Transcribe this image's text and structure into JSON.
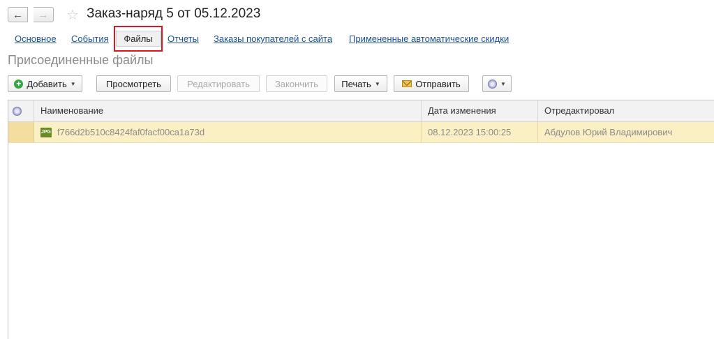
{
  "window": {
    "title": "Заказ-наряд 5 от 05.12.2023",
    "back_glyph": "←",
    "forward_glyph": "→",
    "favorite_glyph": "☆"
  },
  "tabs": [
    {
      "label": "Основное"
    },
    {
      "label": "События"
    },
    {
      "label": "Файлы",
      "active": true
    },
    {
      "label": "Отчеты"
    },
    {
      "label": "Заказы покупателей с сайта"
    },
    {
      "label": "Примененные автоматические скидки"
    }
  ],
  "section_title": "Присоединенные файлы",
  "toolbar": {
    "add": "Добавить",
    "view": "Просмотреть",
    "edit": "Редактировать",
    "finish": "Закончить",
    "print": "Печать",
    "send": "Отправить"
  },
  "icons": {
    "add": "plus-circle-icon",
    "send": "envelope-icon",
    "more": "more-actions-icon",
    "file": "jpg-file-icon"
  },
  "colors": {
    "link": "#1a4f9a",
    "highlight_border": "#e0141e",
    "selected_row": "#fbf0c4",
    "add_icon": "#37a547"
  },
  "table": {
    "columns": [
      "Наименование",
      "Дата изменения",
      "Отредактировал"
    ],
    "rows": [
      {
        "file_badge": "JPG",
        "name": "f766d2b510c8424faf0facf00ca1a73d",
        "modified": "08.12.2023 15:00:25",
        "editor": "Абдулов Юрий Владимирович"
      }
    ]
  }
}
